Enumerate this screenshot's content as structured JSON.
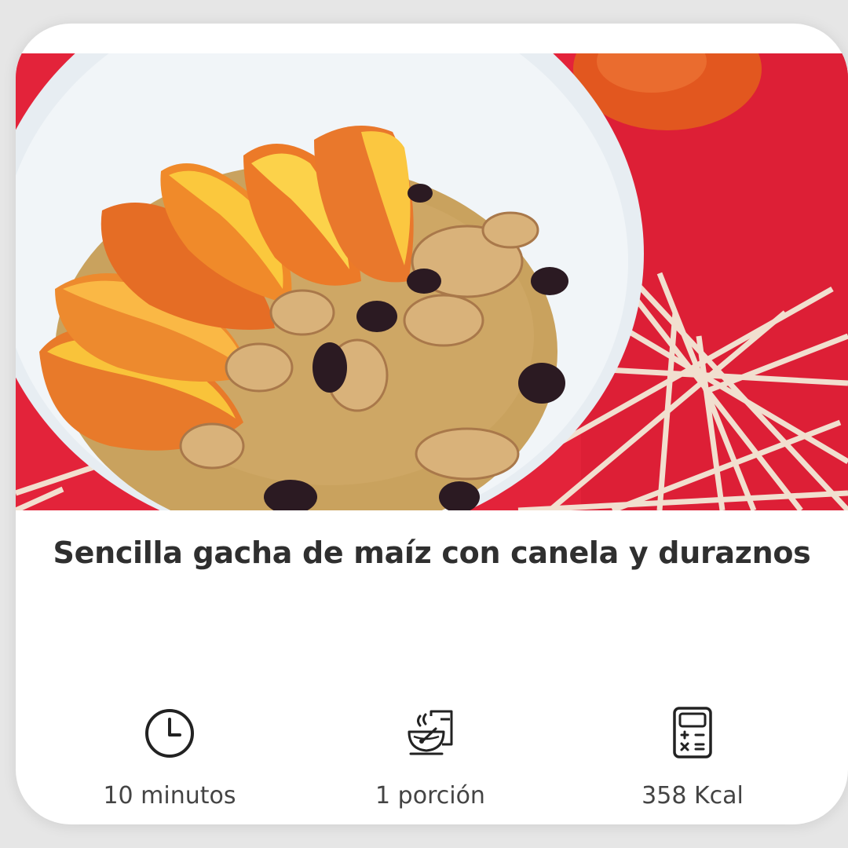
{
  "recipe": {
    "title": "Sencilla gacha de maíz con canela y duraznos",
    "image_alt": "Gacha de maíz con rodajas de durazno, nueces y pasas",
    "stats": {
      "time": {
        "icon": "clock-icon",
        "label": "10 minutos"
      },
      "servings": {
        "icon": "bowl-serving-icon",
        "label": "1 porción"
      },
      "calories": {
        "icon": "calculator-icon",
        "label": "358 Kcal"
      }
    }
  },
  "colors": {
    "background_red": "#e3233a",
    "bowl": "#e9eef2",
    "porridge": "#c9a25e",
    "peach_orange": "#f08a2a",
    "peach_yellow": "#f9c33a",
    "text_dark": "#2f2f2f",
    "text_muted": "#444444"
  }
}
